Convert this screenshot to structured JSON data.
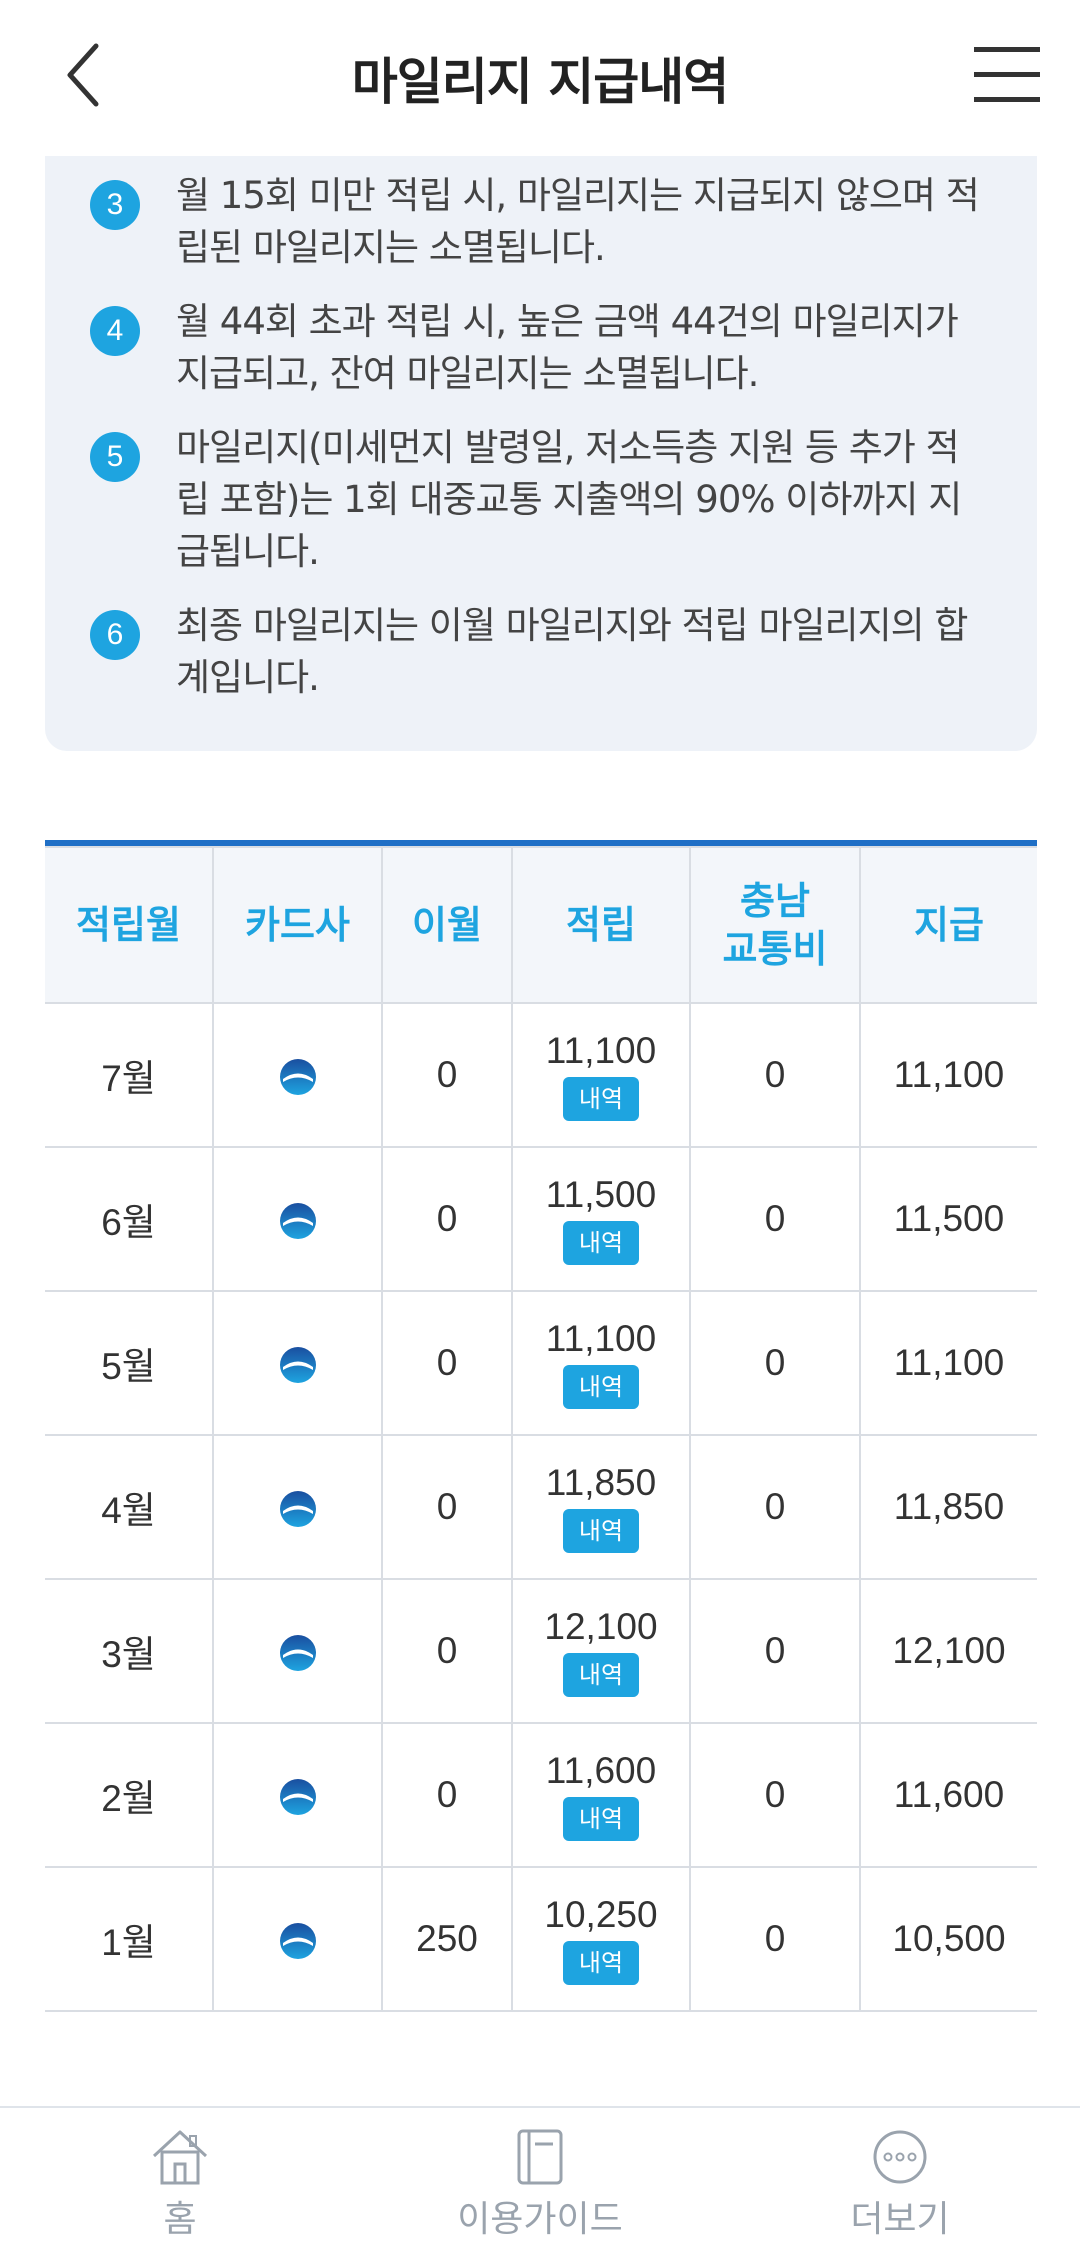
{
  "header": {
    "title": "마일리지 지급내역",
    "back_icon": "back-chevron-icon",
    "menu_icon": "hamburger-menu-icon"
  },
  "notice": {
    "items": [
      {
        "num": "3",
        "text": "월 15회 미만 적립 시, 마일리지는 지급되지 않으며 적립된 마일리지는 소멸됩니다."
      },
      {
        "num": "4",
        "text": "월 44회 초과 적립 시, 높은 금액 44건의 마일리지가 지급되고, 잔여 마일리지는 소멸됩니다."
      },
      {
        "num": "5",
        "text": "마일리지(미세먼지 발령일, 저소득층 지원 등 추가 적립 포함)는 1회 대중교통 지출액의 90% 이하까지 지급됩니다."
      },
      {
        "num": "6",
        "text": "최종 마일리지는 이월 마일리지와 적립 마일리지의 합계입니다."
      }
    ]
  },
  "table": {
    "headers": [
      "적립월",
      "카드사",
      "이월",
      "적립",
      "충남 교통비",
      "지급"
    ],
    "detail_label": "내역",
    "rows": [
      {
        "month": "7월",
        "carry": "0",
        "accum": "11,100",
        "chungnam": "0",
        "pay": "11,100"
      },
      {
        "month": "6월",
        "carry": "0",
        "accum": "11,500",
        "chungnam": "0",
        "pay": "11,500"
      },
      {
        "month": "5월",
        "carry": "0",
        "accum": "11,100",
        "chungnam": "0",
        "pay": "11,100"
      },
      {
        "month": "4월",
        "carry": "0",
        "accum": "11,850",
        "chungnam": "0",
        "pay": "11,850"
      },
      {
        "month": "3월",
        "carry": "0",
        "accum": "12,100",
        "chungnam": "0",
        "pay": "12,100"
      },
      {
        "month": "2월",
        "carry": "0",
        "accum": "11,600",
        "chungnam": "0",
        "pay": "11,600"
      },
      {
        "month": "1월",
        "carry": "250",
        "accum": "10,250",
        "chungnam": "0",
        "pay": "10,500"
      }
    ]
  },
  "bottom_nav": {
    "home": "홈",
    "guide": "이용가이드",
    "more": "더보기"
  },
  "colors": {
    "accent": "#1ea4e0",
    "table_top_border": "#1f6fc6",
    "notice_bg": "#eef2f8"
  }
}
